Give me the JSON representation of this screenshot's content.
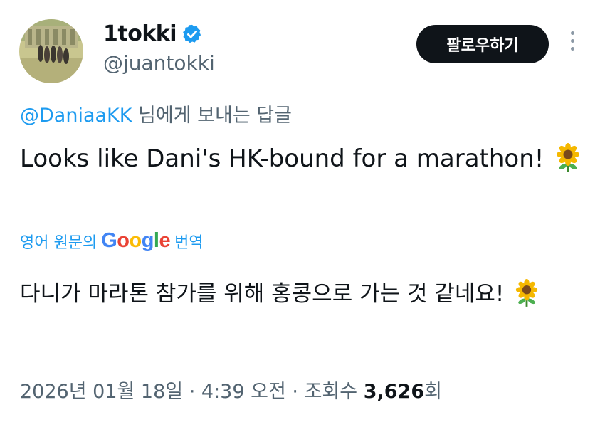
{
  "user": {
    "display_name": "1tokki",
    "handle": "@juantokki",
    "verified_icon": "verified-badge-icon",
    "badge_color": "#1d9bf0"
  },
  "follow_button": {
    "label": "팔로우하기"
  },
  "reply": {
    "mention": "@DaniaaKK",
    "suffix": "님에게 보내는 답글"
  },
  "tweet": {
    "text": "Looks like Dani's HK-bound for a marathon!",
    "emoji": "sunflower-icon"
  },
  "translation": {
    "prefix": "영어 원문의",
    "provider": "Google",
    "suffix": "번역",
    "text": "다니가 마라톤 참가를 위해 홍콩으로 가는 것 같네요!"
  },
  "meta": {
    "date": "2026년 01월 18일",
    "separator": "·",
    "time": "4:39 오전",
    "views_label": "조회수",
    "views_count": "3,626",
    "views_unit": "회"
  }
}
